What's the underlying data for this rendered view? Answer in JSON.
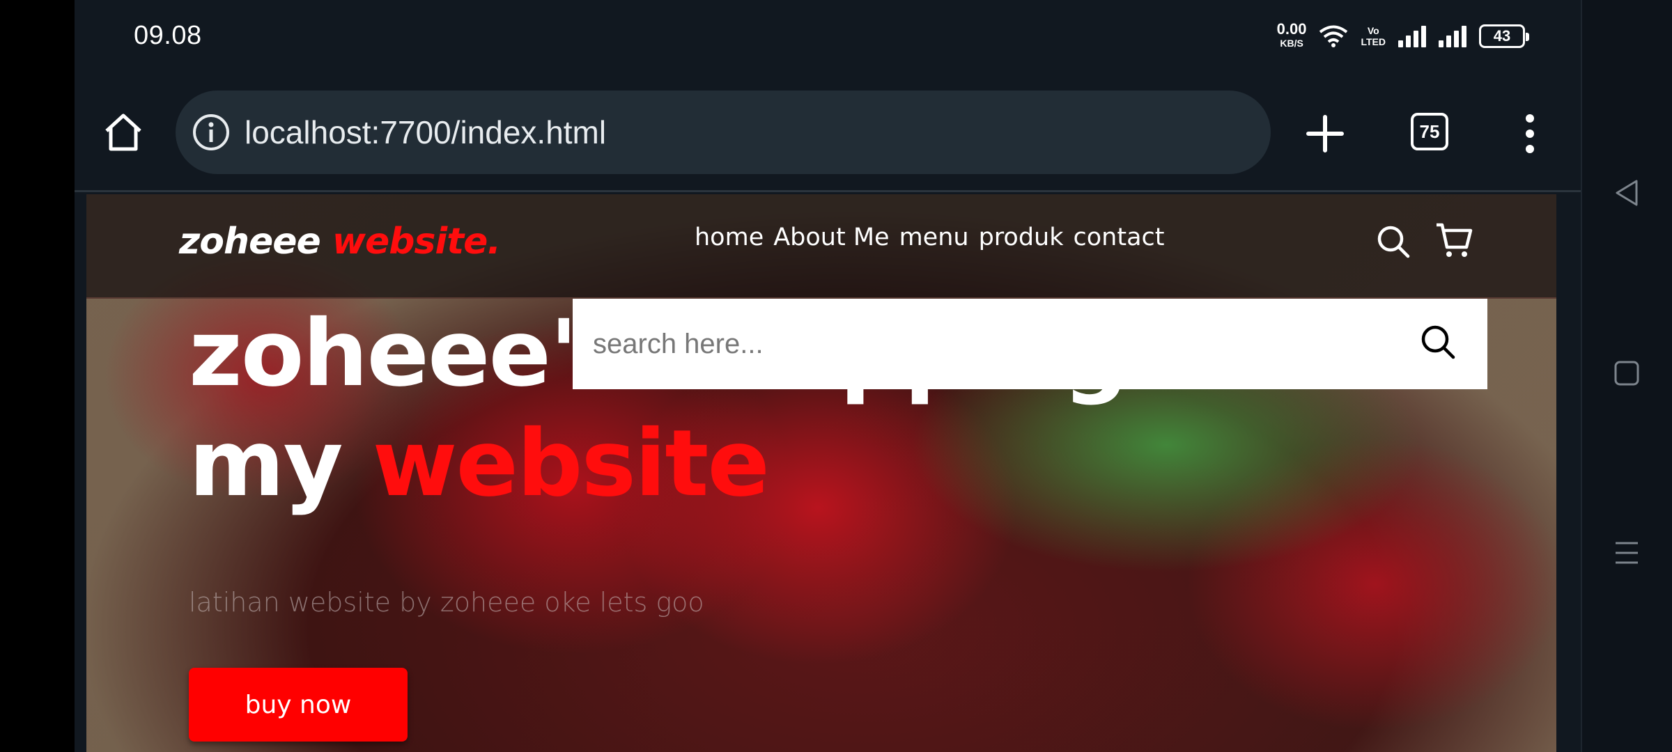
{
  "status_bar": {
    "time": "09.08",
    "net_speed_value": "0.00",
    "net_speed_unit": "KB/S",
    "volte_top": "Vo",
    "volte_bottom": "LTED",
    "battery": "43"
  },
  "browser": {
    "url": "localhost:7700/index.html",
    "tab_count": "75"
  },
  "site": {
    "logo_main": "zoheee",
    "logo_accent": "website.",
    "nav": [
      "home",
      "About Me",
      "menu",
      "produk",
      "contact"
    ],
    "hero_line1": "zoheee's shopping",
    "hero_line2_plain": "my",
    "hero_line2_accent": "website",
    "hero_subtitle": "latihan website by zoheee oke lets goo",
    "buy_button": "buy now",
    "search_placeholder": "search here..."
  },
  "colors": {
    "accent": "#ff0d0d",
    "browser_bg": "#111820",
    "urlbar_bg": "#222d36"
  }
}
